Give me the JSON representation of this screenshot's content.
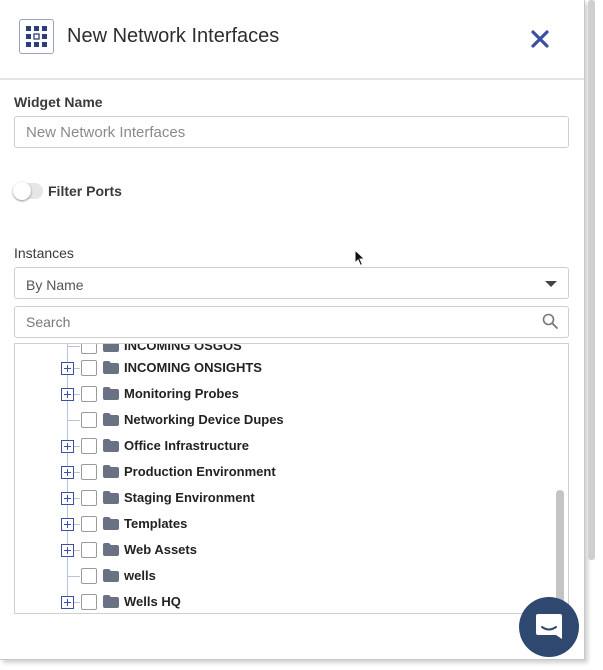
{
  "header": {
    "title": "New Network Interfaces",
    "close_icon": "close-icon",
    "widget_icon": "widget-grid-icon"
  },
  "form": {
    "widget_name_label": "Widget Name",
    "widget_name_placeholder": "New Network Interfaces",
    "filter_ports_label": "Filter Ports",
    "filter_ports_enabled": false,
    "instances_label": "Instances",
    "sort_selected": "By Name",
    "search_placeholder": "Search"
  },
  "tree": {
    "partial_top_label": "INCOMING OSGOS",
    "items": [
      {
        "label": "INCOMING ONSIGHTS",
        "expandable": true
      },
      {
        "label": "Monitoring Probes",
        "expandable": true
      },
      {
        "label": "Networking Device Dupes",
        "expandable": false
      },
      {
        "label": "Office Infrastructure",
        "expandable": true
      },
      {
        "label": "Production Environment",
        "expandable": true
      },
      {
        "label": "Staging Environment",
        "expandable": true
      },
      {
        "label": "Templates",
        "expandable": true
      },
      {
        "label": "Web Assets",
        "expandable": true
      },
      {
        "label": "wells",
        "expandable": false
      },
      {
        "label": "Wells HQ",
        "expandable": true
      }
    ]
  },
  "colors": {
    "accent": "#3b4fa5",
    "chat_button": "#2f4870",
    "folder": "#6b7184"
  }
}
